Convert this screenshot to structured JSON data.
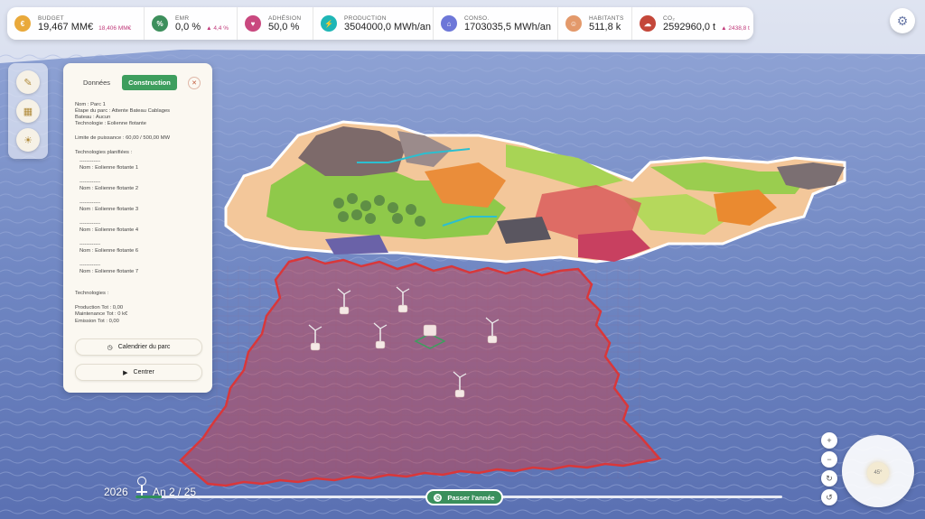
{
  "colors": {
    "accent_green": "#3e9e5e",
    "zone_red": "#d9373a",
    "sea_blue": "#6f86c2",
    "sky": "#c9d3ea"
  },
  "stats": [
    {
      "label": "BUDGET",
      "value": "19,467 MM€",
      "sub": "18,406 MM€",
      "icon": "coin-icon",
      "color": "#e9a93b"
    },
    {
      "label": "EMR",
      "value": "0,0 %",
      "sub": "▲ 4,4 %",
      "icon": "percent-icon",
      "color": "#3d8f5c"
    },
    {
      "label": "ADHÉSION",
      "value": "50,0 %",
      "sub": "",
      "icon": "heart-icon",
      "color": "#c9487f"
    },
    {
      "label": "PRODUCTION",
      "value": "3504000,0 MWh/an",
      "sub": "",
      "icon": "production-icon",
      "color": "#1fb6b6"
    },
    {
      "label": "CONSO.",
      "value": "1703035,5 MWh/an",
      "sub": "",
      "icon": "consumption-icon",
      "color": "#6d77d8"
    },
    {
      "label": "HABITANTS",
      "value": "511,8 k",
      "sub": "",
      "icon": "people-icon",
      "color": "#e3996b"
    },
    {
      "label": "CO₂",
      "value": "2592960,0 t",
      "sub": "▲ 2438,8 t",
      "icon": "co2-icon",
      "color": "#c4473a"
    }
  ],
  "tools": [
    {
      "icon": "wind-icon"
    },
    {
      "icon": "grid-icon"
    },
    {
      "icon": "sun-icon"
    }
  ],
  "panel": {
    "tabs": [
      "Données",
      "Construction"
    ],
    "active_tab": "Construction",
    "info_lines": [
      "Nom : Parc 1",
      "Étape du parc : Attente Bateau Cablages",
      "Bateau : Aucun",
      "Technologie : Eolienne flotante"
    ],
    "power_limit": "Limite de puissance : 60,00 / 500,00 MW",
    "planned_title": "Technologies planifiées :",
    "separator": "------------",
    "planned": [
      "Nom : Eolienne flotante 1",
      "Nom : Eolienne flotante 2",
      "Nom : Eolienne flotante 3",
      "Nom : Eolienne flotante 4",
      "Nom : Eolienne flotante 6",
      "Nom : Eolienne flotante 7"
    ],
    "technologies_title": "Technologies :",
    "totals": [
      "Production Tot : 0,00",
      "Maintenance Tot : 0 k€",
      "Emission Tot : 0,00"
    ],
    "calendar_button": "Calendrier du parc",
    "center_button": "Centrer"
  },
  "timeline": {
    "year": "2026",
    "turn": "An 2 / 25",
    "progress": 0.04,
    "next_button": "Passer l'année"
  },
  "camera": {
    "controls": [
      "+",
      "−",
      "↻",
      "↺"
    ],
    "angle": "45°"
  }
}
